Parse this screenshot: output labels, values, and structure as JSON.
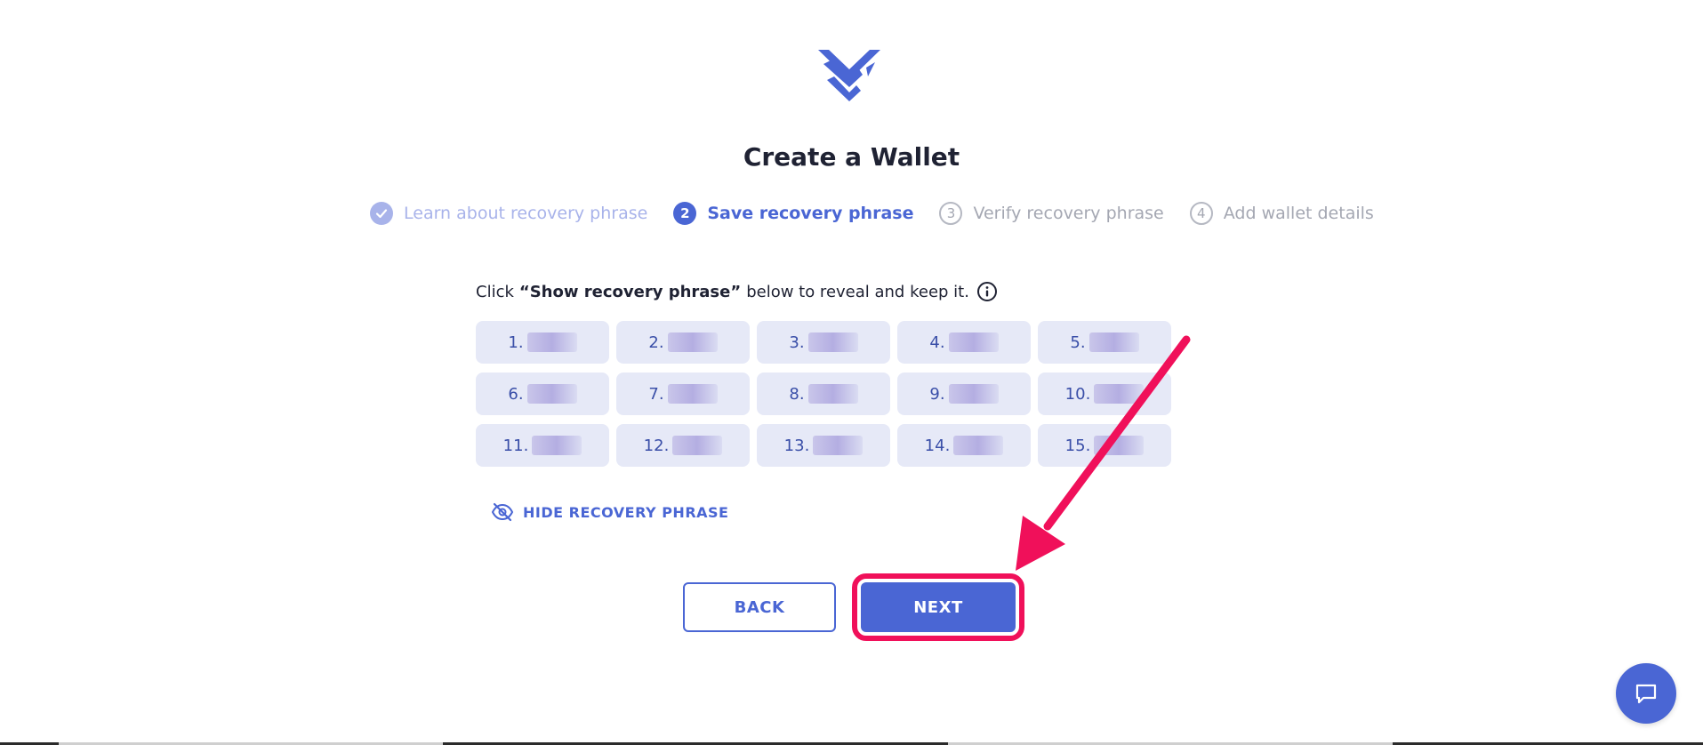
{
  "page": {
    "title": "Create a Wallet"
  },
  "stepper": {
    "steps": [
      {
        "number": "",
        "label": "Learn about recovery phrase",
        "state": "done"
      },
      {
        "number": "2",
        "label": "Save recovery phrase",
        "state": "active"
      },
      {
        "number": "3",
        "label": "Verify recovery phrase",
        "state": "todo"
      },
      {
        "number": "4",
        "label": "Add wallet details",
        "state": "todo"
      }
    ]
  },
  "instruction": {
    "prefix": "Click",
    "emphasis": "“Show recovery phrase”",
    "suffix": "below to reveal and keep it."
  },
  "phrase": {
    "words": [
      {
        "index": "1."
      },
      {
        "index": "2."
      },
      {
        "index": "3."
      },
      {
        "index": "4."
      },
      {
        "index": "5."
      },
      {
        "index": "6."
      },
      {
        "index": "7."
      },
      {
        "index": "8."
      },
      {
        "index": "9."
      },
      {
        "index": "10."
      },
      {
        "index": "11."
      },
      {
        "index": "12."
      },
      {
        "index": "13."
      },
      {
        "index": "14."
      },
      {
        "index": "15."
      }
    ]
  },
  "toggle": {
    "label": "HIDE RECOVERY PHRASE",
    "icon": "eye-off-icon"
  },
  "actions": {
    "back_label": "BACK",
    "next_label": "NEXT"
  },
  "colors": {
    "accent": "#4a66d4",
    "highlight": "#f0105a",
    "word_bg": "#e6e9f7"
  },
  "icons": {
    "logo": "wallet-logo-icon",
    "info": "info-icon",
    "chat": "chat-icon",
    "check": "check-icon"
  }
}
